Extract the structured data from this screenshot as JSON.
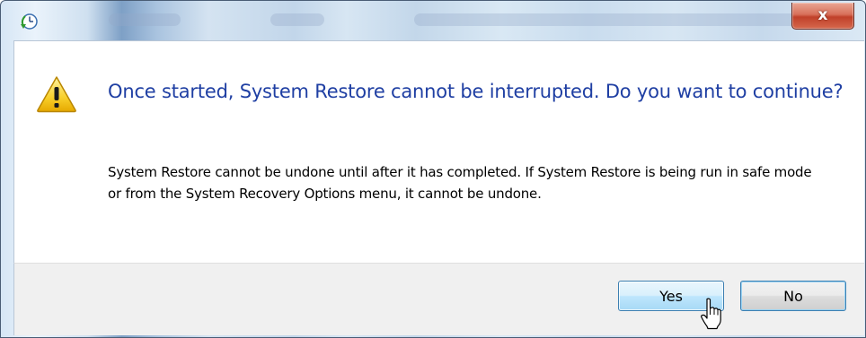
{
  "dialog": {
    "main_instruction": "Once started, System Restore cannot be interrupted. Do you want to continue?",
    "content_text": "System Restore cannot be undone until after it has completed. If System Restore is being run in safe mode or from the System Recovery Options menu, it cannot be undone.",
    "icon": "warning-icon"
  },
  "titlebar": {
    "icon": "system-restore-icon",
    "close_label": "x"
  },
  "buttons": {
    "yes_label": "Yes",
    "no_label": "No"
  },
  "colors": {
    "instruction_text": "#1f3fa3",
    "close_button": "#c0412a",
    "footer_background": "#f0f0f0"
  }
}
